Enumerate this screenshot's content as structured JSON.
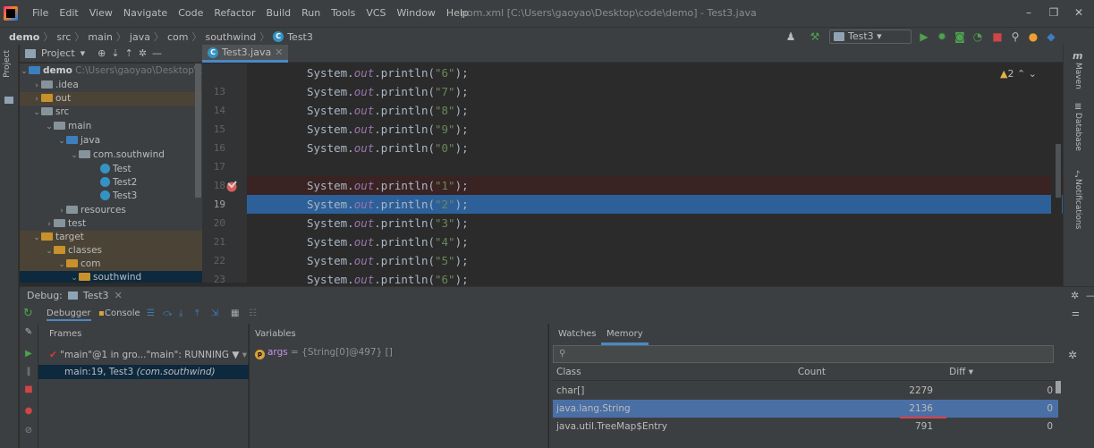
{
  "titlebar": {
    "menus": [
      "File",
      "Edit",
      "View",
      "Navigate",
      "Code",
      "Refactor",
      "Build",
      "Run",
      "Tools",
      "VCS",
      "Window",
      "Help"
    ],
    "window_title": "pom.xml [C:\\Users\\gaoyao\\Desktop\\code\\demo] - Test3.java"
  },
  "navbar": {
    "crumbs": [
      "demo",
      "src",
      "main",
      "java",
      "com",
      "southwind",
      "Test3"
    ],
    "run_config": "Test3"
  },
  "left_stripe": {
    "label": "Project"
  },
  "project": {
    "header": "Project",
    "tree": [
      {
        "text": "demo",
        "path": "C:\\Users\\gaoyao\\Desktop\\code\\demo"
      },
      {
        "text": ".idea"
      },
      {
        "text": "out"
      },
      {
        "text": "src"
      },
      {
        "text": "main"
      },
      {
        "text": "java"
      },
      {
        "text": "com.southwind"
      },
      {
        "text": "Test"
      },
      {
        "text": "Test2"
      },
      {
        "text": "Test3"
      },
      {
        "text": "resources"
      },
      {
        "text": "test"
      },
      {
        "text": "target"
      },
      {
        "text": "classes"
      },
      {
        "text": "com"
      },
      {
        "text": "southwind"
      }
    ]
  },
  "editor": {
    "tab": "Test3.java",
    "warnings": "2",
    "line_numbers": [
      "13",
      "14",
      "15",
      "16",
      "17",
      "18",
      "19",
      "20",
      "21",
      "22",
      "23"
    ],
    "lines": [
      {
        "pre": "System.",
        "fld": "out",
        "mid": ".println(",
        "str": "\"6\"",
        "post": ");"
      },
      {
        "pre": "System.",
        "fld": "out",
        "mid": ".println(",
        "str": "\"7\"",
        "post": ");"
      },
      {
        "pre": "System.",
        "fld": "out",
        "mid": ".println(",
        "str": "\"8\"",
        "post": ");"
      },
      {
        "pre": "System.",
        "fld": "out",
        "mid": ".println(",
        "str": "\"9\"",
        "post": ");"
      },
      {
        "pre": "System.",
        "fld": "out",
        "mid": ".println(",
        "str": "\"0\"",
        "post": ");"
      },
      {
        "pre": "",
        "fld": "",
        "mid": "",
        "str": "",
        "post": ""
      },
      {
        "pre": "System.",
        "fld": "out",
        "mid": ".println(",
        "str": "\"1\"",
        "post": ");"
      },
      {
        "pre": "System.",
        "fld": "out",
        "mid": ".println(",
        "str": "\"2\"",
        "post": ");"
      },
      {
        "pre": "System.",
        "fld": "out",
        "mid": ".println(",
        "str": "\"3\"",
        "post": ");"
      },
      {
        "pre": "System.",
        "fld": "out",
        "mid": ".println(",
        "str": "\"4\"",
        "post": ");"
      },
      {
        "pre": "System.",
        "fld": "out",
        "mid": ".println(",
        "str": "\"5\"",
        "post": ");"
      },
      {
        "pre": "System.",
        "fld": "out",
        "mid": ".println(",
        "str": "\"6\"",
        "post": ");"
      }
    ]
  },
  "right_stripe": [
    "Maven",
    "Database",
    "Notifications"
  ],
  "debug": {
    "label": "Debug:",
    "session_tab": "Test3",
    "tabs": [
      "Debugger",
      "Console"
    ],
    "frames_title": "Frames",
    "thread": "\"main\"@1 in gro...\"main\": RUNNING",
    "frame": "main:19, Test3",
    "frame_pkg": "(com.southwind)",
    "variables_title": "Variables",
    "variable": {
      "name": "args",
      "value": " = {String[0]@497} []"
    }
  },
  "memory": {
    "tabs": [
      "Watches",
      "Memory"
    ],
    "columns": [
      "Class",
      "Count",
      "Diff"
    ],
    "rows": [
      {
        "class": "char[]",
        "count": "2279",
        "diff": "0"
      },
      {
        "class": "java.lang.String",
        "count": "2136",
        "diff": "0"
      },
      {
        "class": "java.util.TreeMap$Entry",
        "count": "791",
        "diff": "0"
      }
    ]
  },
  "colors": {
    "accent": "#4a88c7",
    "selection": "#2d6099",
    "breakpoint_line": "#3a2323",
    "string": "#6a8759",
    "field": "#9876aa"
  }
}
